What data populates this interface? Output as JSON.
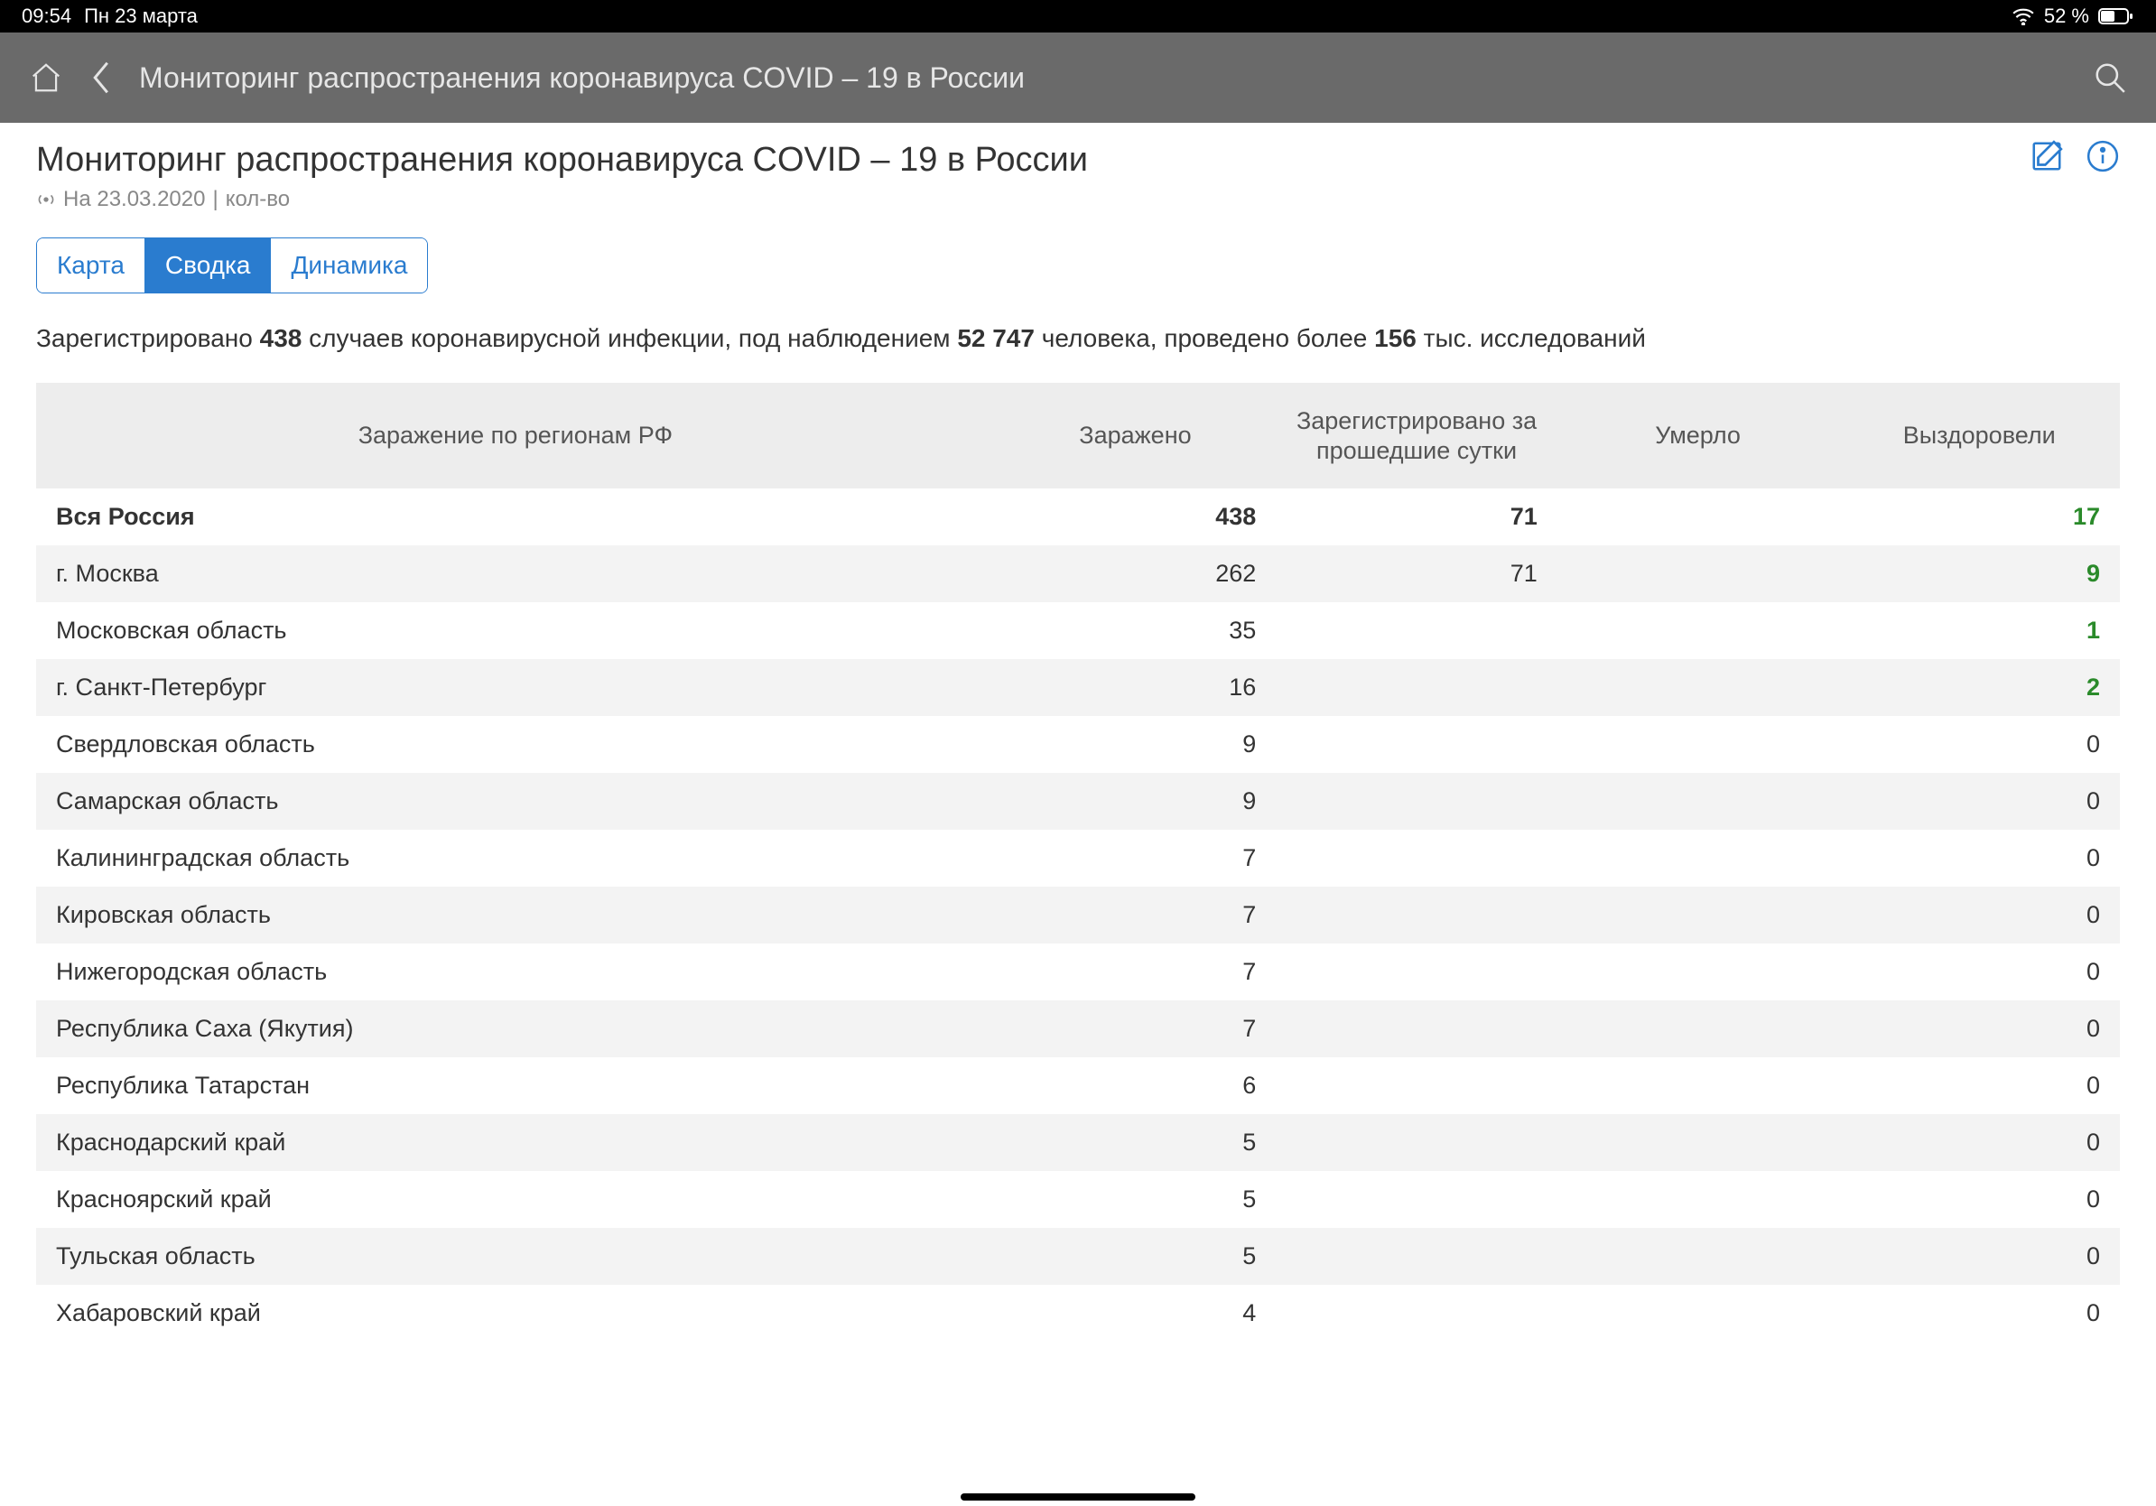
{
  "status": {
    "time": "09:54",
    "date": "Пн 23 марта",
    "battery_pct": "52 %"
  },
  "header": {
    "title": "Мониторинг распространения коронавируса COVID – 19 в России"
  },
  "page": {
    "title": "Мониторинг распространения коронавируса COVID – 19 в России",
    "subtitle_prefix": "На 23.03.2020",
    "subtitle_suffix": "кол-во"
  },
  "tabs": {
    "map": "Карта",
    "summary": "Сводка",
    "dynamics": "Динамика"
  },
  "summary": {
    "t1": "Зарегистрировано",
    "v1": "438",
    "t2": "случаев коронавирусной инфекции, под наблюдением",
    "v2": "52 747",
    "t3": "человека, проведено более",
    "v3": "156",
    "t4": "тыс. исследований"
  },
  "table": {
    "headers": {
      "region": "Заражение по регионам РФ",
      "infected": "Заражено",
      "last24": "Зарегистрировано за прошедшие сутки",
      "deaths": "Умерло",
      "recovered": "Выздоровели"
    },
    "total_row": {
      "region": "Вся Россия",
      "infected": "438",
      "last24": "71",
      "deaths": "",
      "recovered": "17"
    },
    "rows": [
      {
        "region": "г. Москва",
        "infected": "262",
        "last24": "71",
        "deaths": "",
        "recovered": "9",
        "recovered_green": true
      },
      {
        "region": "Московская область",
        "infected": "35",
        "last24": "",
        "deaths": "",
        "recovered": "1",
        "recovered_green": true
      },
      {
        "region": "г. Санкт-Петербург",
        "infected": "16",
        "last24": "",
        "deaths": "",
        "recovered": "2",
        "recovered_green": true
      },
      {
        "region": "Свердловская область",
        "infected": "9",
        "last24": "",
        "deaths": "",
        "recovered": "0"
      },
      {
        "region": "Самарская область",
        "infected": "9",
        "last24": "",
        "deaths": "",
        "recovered": "0"
      },
      {
        "region": "Калининградская область",
        "infected": "7",
        "last24": "",
        "deaths": "",
        "recovered": "0"
      },
      {
        "region": "Кировская область",
        "infected": "7",
        "last24": "",
        "deaths": "",
        "recovered": "0"
      },
      {
        "region": "Нижегородская область",
        "infected": "7",
        "last24": "",
        "deaths": "",
        "recovered": "0"
      },
      {
        "region": "Республика Саха (Якутия)",
        "infected": "7",
        "last24": "",
        "deaths": "",
        "recovered": "0"
      },
      {
        "region": "Республика Татарстан",
        "infected": "6",
        "last24": "",
        "deaths": "",
        "recovered": "0"
      },
      {
        "region": "Краснодарский край",
        "infected": "5",
        "last24": "",
        "deaths": "",
        "recovered": "0"
      },
      {
        "region": "Красноярский край",
        "infected": "5",
        "last24": "",
        "deaths": "",
        "recovered": "0"
      },
      {
        "region": "Тульская область",
        "infected": "5",
        "last24": "",
        "deaths": "",
        "recovered": "0"
      },
      {
        "region": "Хабаровский край",
        "infected": "4",
        "last24": "",
        "deaths": "",
        "recovered": "0"
      }
    ]
  },
  "colors": {
    "accent": "#2a7ccf",
    "green": "#2a8a2a",
    "header_bg": "#6a6a6a"
  }
}
